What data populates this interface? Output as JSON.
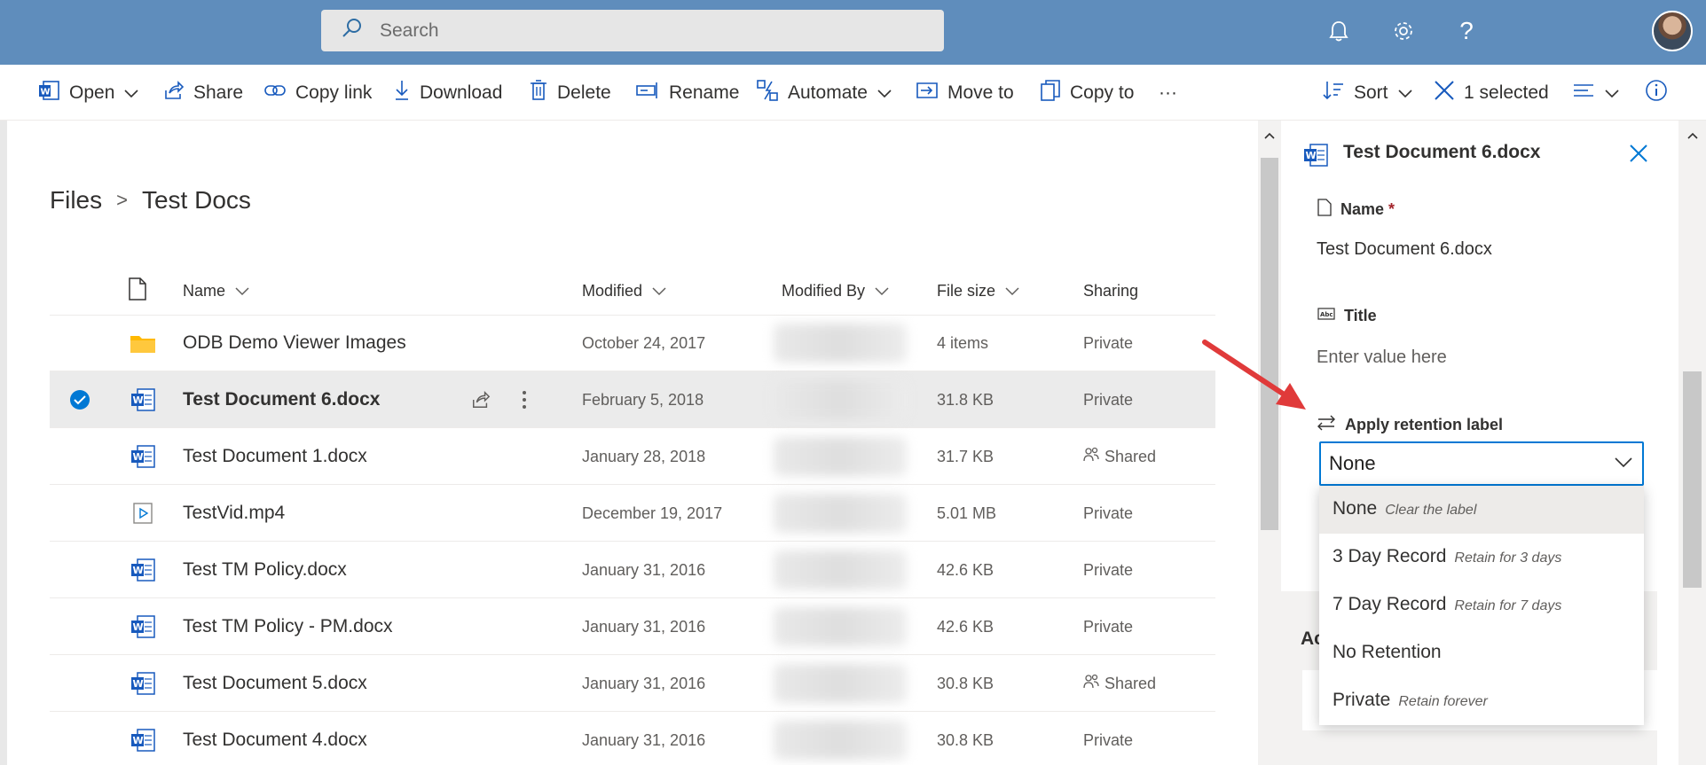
{
  "search": {
    "placeholder": "Search"
  },
  "toolbar": {
    "open": "Open",
    "share": "Share",
    "copy_link": "Copy link",
    "download": "Download",
    "delete": "Delete",
    "rename": "Rename",
    "automate": "Automate",
    "move_to": "Move to",
    "copy_to": "Copy to",
    "more": "···",
    "sort": "Sort",
    "selected": "1 selected"
  },
  "breadcrumb": {
    "root": "Files",
    "separator": ">",
    "current": "Test Docs"
  },
  "columns": {
    "name": "Name",
    "modified": "Modified",
    "modified_by": "Modified By",
    "file_size": "File size",
    "sharing": "Sharing"
  },
  "rows": [
    {
      "name": "ODB Demo Viewer Images",
      "modified": "October 24, 2017",
      "size": "4 items",
      "sharing": "Private",
      "icon": "folder-icon"
    },
    {
      "name": "Test Document 6.docx",
      "modified": "February 5, 2018",
      "size": "31.8 KB",
      "sharing": "Private",
      "icon": "word-icon",
      "selected": true
    },
    {
      "name": "Test Document 1.docx",
      "modified": "January 28, 2018",
      "size": "31.7 KB",
      "sharing": "Shared",
      "icon": "word-icon"
    },
    {
      "name": "TestVid.mp4",
      "modified": "December 19, 2017",
      "size": "5.01 MB",
      "sharing": "Private",
      "icon": "video-icon"
    },
    {
      "name": "Test TM Policy.docx",
      "modified": "January 31, 2016",
      "size": "42.6 KB",
      "sharing": "Private",
      "icon": "word-icon"
    },
    {
      "name": "Test TM Policy - PM.docx",
      "modified": "January 31, 2016",
      "size": "42.6 KB",
      "sharing": "Private",
      "icon": "word-icon"
    },
    {
      "name": "Test Document 5.docx",
      "modified": "January 31, 2016",
      "size": "30.8 KB",
      "sharing": "Shared",
      "icon": "word-icon"
    },
    {
      "name": "Test Document 4.docx",
      "modified": "January 31, 2016",
      "size": "30.8 KB",
      "sharing": "Private",
      "icon": "word-icon"
    }
  ],
  "details": {
    "title": "Test Document 6.docx",
    "name_label": "Name",
    "required_mark": "*",
    "name_value": "Test Document 6.docx",
    "title_label": "Title",
    "title_placeholder": "Enter value here",
    "retention_label": "Apply retention label",
    "retention_value": "None",
    "options": [
      {
        "label": "None",
        "desc": "Clear the label"
      },
      {
        "label": "3 Day Record",
        "desc": "Retain for 3 days"
      },
      {
        "label": "7 Day Record",
        "desc": "Retain for 7 days"
      },
      {
        "label": "No Retention",
        "desc": ""
      },
      {
        "label": "Private",
        "desc": "Retain forever"
      }
    ],
    "activity_partial": "Ac"
  },
  "colors": {
    "topbar": "#5f8dbc",
    "accent": "#0078d4",
    "word_blue": "#185abd",
    "folder": "#ffb900",
    "annotation_arrow": "#e03a3a"
  }
}
